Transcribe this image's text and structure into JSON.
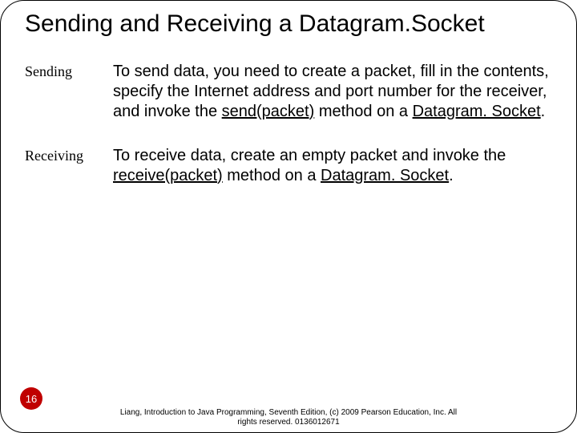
{
  "slide": {
    "title": "Sending and Receiving a Datagram.Socket",
    "rows": [
      {
        "label": "Sending",
        "prefix": "To send data, you need to create a packet, fill in the contents, specify the Internet address and port number for the receiver, and invoke the ",
        "u1": "send(packet)",
        "mid": " method on a ",
        "u2": "Datagram. Socket",
        "suffix": "."
      },
      {
        "label": "Receiving",
        "prefix": "To receive data, create an empty packet and invoke the ",
        "u1": "receive(packet)",
        "mid": " method on a ",
        "u2": "Datagram. Socket",
        "suffix": "."
      }
    ],
    "number": "16",
    "footer_line1": "Liang, Introduction to Java Programming, Seventh Edition, (c) 2009 Pearson Education, Inc. All",
    "footer_line2": "rights reserved. 0136012671"
  }
}
